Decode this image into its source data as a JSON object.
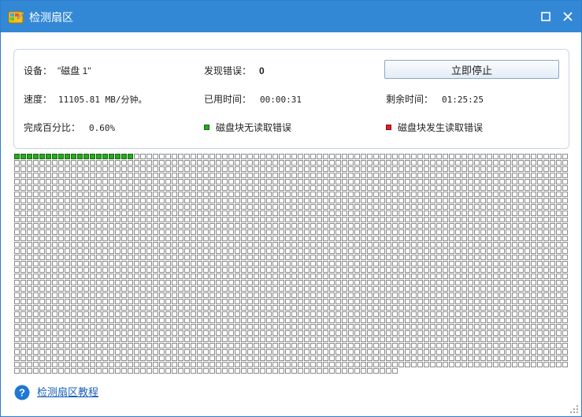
{
  "window": {
    "title": "检测扇区"
  },
  "info": {
    "device_label": "设备：",
    "device_value": "\"磁盘 1\"",
    "errors_label": "发现错误：",
    "errors_value": "0",
    "speed_label": "速度：",
    "speed_value": "11105.81 MB/分钟。",
    "elapsed_label": "已用时间：",
    "elapsed_value": "00:00:31",
    "remaining_label": "剩余时间：",
    "remaining_value": "01:25:25",
    "percent_label": "完成百分比：",
    "percent_value": "0.60%",
    "legend_ok": "磁盘块无读取错误",
    "legend_bad": "磁盘块发生读取错误",
    "stop_button": "立即停止"
  },
  "grid": {
    "columns": 88,
    "rows": 35,
    "total_blocks": 3053,
    "checked_blocks": 19
  },
  "footer": {
    "help_link": "检测扇区教程"
  },
  "colors": {
    "titlebar": "#3388d6",
    "ok_block": "#2aa820",
    "bad_block": "#e02020",
    "link": "#1a5fb4"
  }
}
